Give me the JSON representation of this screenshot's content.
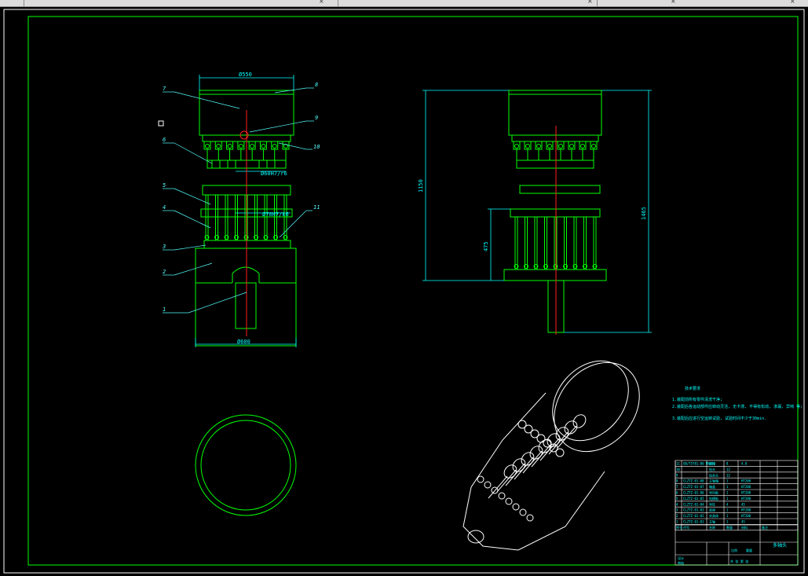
{
  "titlebar": {
    "close_glyph": "×"
  },
  "front_view": {
    "dim_top": "Ø550",
    "dim_bottom": "Ø600",
    "fit_1": "Ø60H7/r6",
    "fit_2": "Ø70H7/k6",
    "callouts": [
      "1",
      "2",
      "3",
      "4",
      "5",
      "6",
      "7",
      "8",
      "9",
      "10",
      "11"
    ]
  },
  "side_view": {
    "dim_overall": "1465",
    "dim_mid": "1150",
    "dim_low": "475"
  },
  "notes": {
    "title": "技术要求",
    "lines": [
      "1.装配前所有零件清洗干净;",
      "2.装配后各运动部件应转动灵活, 无卡滞, 不得有松动, 渗漏, 异响 等;",
      "3.装配后应进行空运转试验, 试验时间不少于30min."
    ]
  },
  "bom": {
    "rows": [
      {
        "no": "11",
        "code": "GB/T5781-86 M8×30",
        "name": "螺栓",
        "qty": "8",
        "mat": "4.8",
        "note": ""
      },
      {
        "no": "10",
        "code": "",
        "name": "钻头",
        "qty": "12",
        "mat": "",
        "note": ""
      },
      {
        "no": "9",
        "code": "",
        "name": "钻夹头",
        "qty": "12",
        "mat": "",
        "note": ""
      },
      {
        "no": "8",
        "code": "CLZTZ-01-08",
        "name": "主轴箱",
        "qty": "1",
        "mat": "HT200",
        "note": ""
      },
      {
        "no": "7",
        "code": "CLZTZ-01-07",
        "name": "箱盖",
        "qty": "1",
        "mat": "HT200",
        "note": ""
      },
      {
        "no": "6",
        "code": "CLZTZ-01-06",
        "name": "导向板",
        "qty": "1",
        "mat": "HT200",
        "note": ""
      },
      {
        "no": "5",
        "code": "CLZTZ-01-05",
        "name": "钻模板",
        "qty": "1",
        "mat": "HT200",
        "note": ""
      },
      {
        "no": "4",
        "code": "CLZTZ-01-04",
        "name": "导柱",
        "qty": "4",
        "mat": "45",
        "note": ""
      },
      {
        "no": "3",
        "code": "CLZTZ-01-03",
        "name": "底座",
        "qty": "1",
        "mat": "HT200",
        "note": ""
      },
      {
        "no": "2",
        "code": "CLZTZ-01-02",
        "name": "夹具体",
        "qty": "1",
        "mat": "HT200",
        "note": ""
      },
      {
        "no": "1",
        "code": "CLZTZ-01-01",
        "name": "主轴",
        "qty": "1",
        "mat": "45",
        "note": ""
      }
    ],
    "header": [
      "序号",
      "代号",
      "名称",
      "数量",
      "材料",
      "备注"
    ],
    "title": "多轴头",
    "scale_label": "比例",
    "weight_label": "重量",
    "design_label": "设计",
    "check_label": "审核",
    "sheet_label": "共 张 第 张"
  },
  "colors": {
    "outline": "#00ff00",
    "dims": "#00ffff",
    "cutline": "#ff2020",
    "iso": "#ffffff",
    "callout": "#55ffff"
  }
}
